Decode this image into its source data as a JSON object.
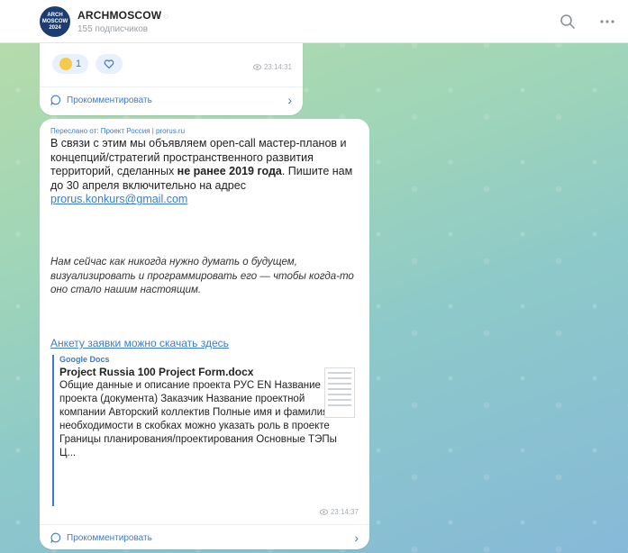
{
  "header": {
    "title": "ARCHMOSCOW",
    "subscribers": "155 подписчиков",
    "avatar_text": "ARCH MOSCOW 2024",
    "search_icon": "search-icon",
    "more_icon": "more-icon"
  },
  "post1": {
    "reaction_count": "1",
    "time": "23:14:31",
    "comment_label": "Прокомментировать"
  },
  "post2": {
    "forwarded_from": "Переслано от: Проект Россия | prorus.ru",
    "text_part1": "В связи с этим мы объявляем open-call мастер-планов и концепций/стратегий пространственного развития территорий, сделанных ",
    "text_bold": "не ранее 2019 года",
    "text_part2": ". Пишите нам до 30 апреля включительно на адрес",
    "email": "prorus.konkurs@gmail.com",
    "italic_text": "Нам сейчас как никогда нужно думать о будущем, визуализировать и программировать его — чтобы когда-то оно стало нашим настоящим.",
    "apply_link": "Анкету заявки можно скачать здесь",
    "preview": {
      "source": "Google Docs",
      "title": "Project Russia 100 Project Form.docx",
      "description": "Общие данные и описание проекта РУС EN Название проекта (документа) Заказчик Название проектной компании Авторский коллектив Полные имя и фамилия, при необходимости в скобках можно указать роль в проекте Границы планирования/проектирования Основные ТЭПы Ц..."
    },
    "time": "23:14:37",
    "comment_label": "Прокомментировать"
  },
  "colors": {
    "accent": "#3a7bd5",
    "header_bg": "#ffffff",
    "avatar_bg": "#1d3d72"
  }
}
